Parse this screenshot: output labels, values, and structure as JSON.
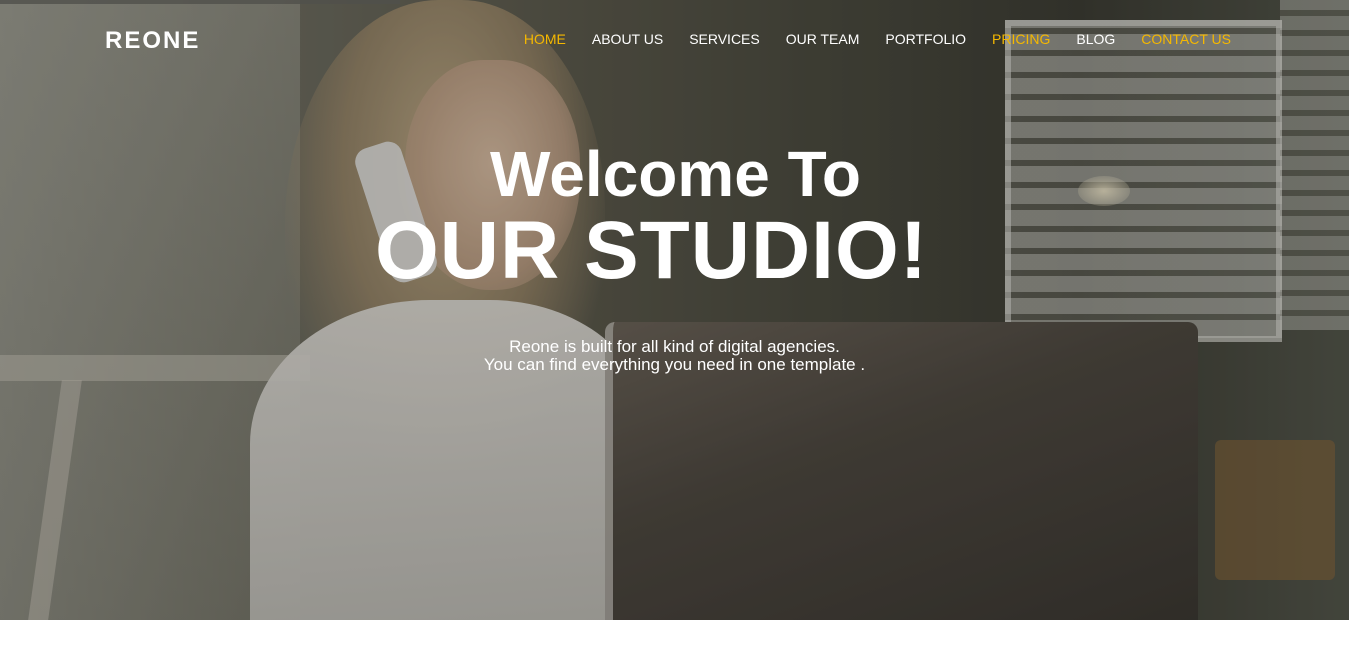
{
  "brand": {
    "logo_text": "REONE"
  },
  "nav": {
    "items": [
      {
        "label": "HOME",
        "color": "#f5b800"
      },
      {
        "label": "ABOUT US",
        "color": "#ffffff"
      },
      {
        "label": "SERVICES",
        "color": "#ffffff"
      },
      {
        "label": "OUR TEAM",
        "color": "#ffffff"
      },
      {
        "label": "PORTFOLIO",
        "color": "#ffffff"
      },
      {
        "label": "PRICING",
        "color": "#f5b800"
      },
      {
        "label": "BLOG",
        "color": "#ffffff"
      },
      {
        "label": "CONTACT US",
        "color": "#f5b800"
      }
    ]
  },
  "hero": {
    "title_line1": "Welcome To",
    "title_line2": "OUR STUDIO!",
    "description_line1": "Reone is built for all kind of digital agencies.",
    "description_line2": "You can find everything you need in one template ."
  },
  "colors": {
    "accent": "#f5b800",
    "text": "#ffffff"
  }
}
